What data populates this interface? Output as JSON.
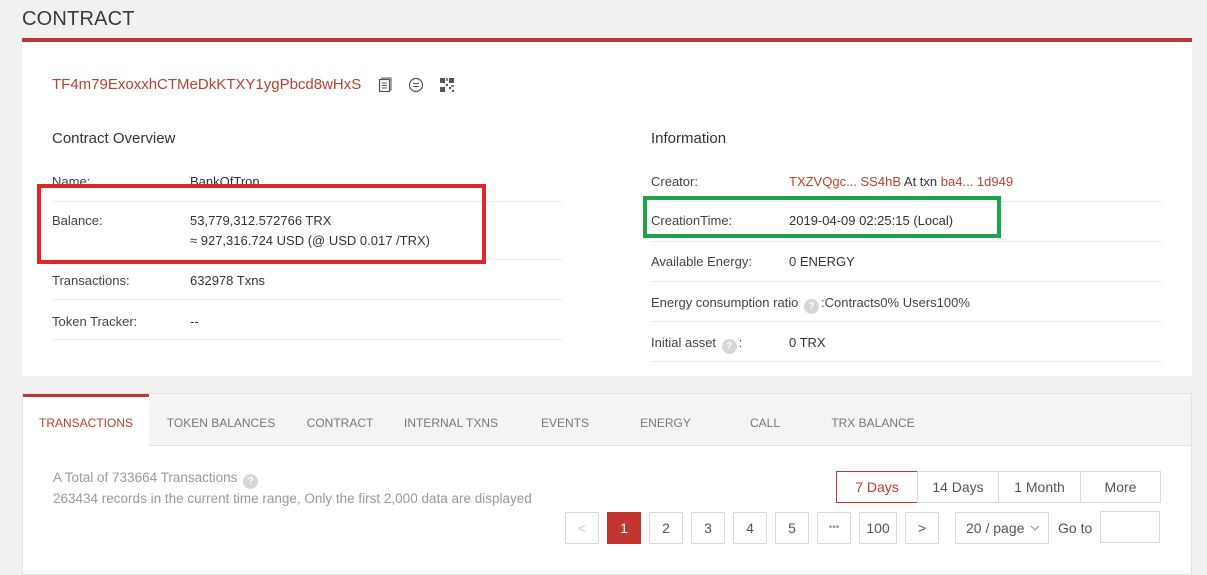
{
  "page_title": "CONTRACT",
  "contract": {
    "address": "TF4m79ExoxxhCTMeDkKTXY1ygPbcd8wHxS",
    "icons": [
      "copy-icon",
      "chat-icon",
      "qr-code-icon"
    ]
  },
  "overview": {
    "title": "Contract Overview",
    "rows": [
      {
        "label": "Name:",
        "value": "BankOfTron"
      },
      {
        "label": "Balance:",
        "value": "53,779,312.572766 TRX",
        "value2": "≈ 927,316.724 USD (@ USD 0.017 /TRX)"
      },
      {
        "label": "Transactions:",
        "value": "632978  Txns"
      },
      {
        "label": "Token Tracker:",
        "value": "--"
      }
    ]
  },
  "information": {
    "title": "Information",
    "creator_label": "Creator:",
    "creator_addr": "TXZVQgc... SS4hB",
    "creator_mid": "At txn",
    "creator_txn": "ba4... 1d949",
    "creation_label": "CreationTime:",
    "creation_value": "2019-04-09 02:25:15 (Local)",
    "energy_label": "Available Energy:",
    "energy_value": "0  ENERGY",
    "ratio_label": "Energy consumption ratio",
    "ratio_value": ":Contracts0%  Users100%",
    "asset_label": "Initial asset",
    "asset_colon": ":",
    "asset_value": "0 TRX",
    "help_glyph": "?"
  },
  "highlight_colors": {
    "red": "#e0262d",
    "green": "#1ea34a"
  },
  "tabs": [
    "TRANSACTIONS",
    "TOKEN BALANCES",
    "CONTRACT",
    "INTERNAL TXNS",
    "EVENTS",
    "ENERGY",
    "CALL",
    "TRX BALANCE"
  ],
  "summary": {
    "total": "A Total of 733664 Transactions",
    "note": "263434 records in the current time range, Only the first 2,000 data are displayed"
  },
  "ranges": [
    "7 Days",
    "14 Days",
    "1 Month",
    "More"
  ],
  "pagination": {
    "prev": "<",
    "pages": [
      "1",
      "2",
      "3",
      "4",
      "5"
    ],
    "ellipsis": "•••",
    "last": "100",
    "next": ">",
    "page_size": "20 / page",
    "goto": "Go to"
  }
}
